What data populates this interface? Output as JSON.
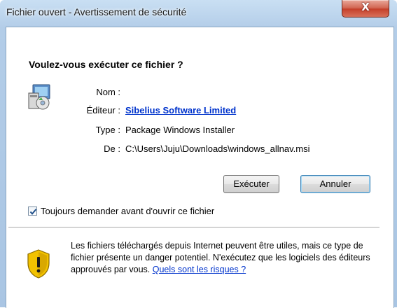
{
  "window": {
    "title": "Fichier ouvert - Avertissement de sécurité",
    "close_glyph": "X"
  },
  "question": "Voulez-vous exécuter ce fichier ?",
  "details": {
    "name_label": "Nom :",
    "name_value": "",
    "publisher_label": "Éditeur :",
    "publisher_value": "Sibelius Software Limited",
    "type_label": "Type :",
    "type_value": "Package Windows Installer",
    "from_label": "De :",
    "from_value": "C:\\Users\\Juju\\Downloads\\windows_allnav.msi"
  },
  "buttons": {
    "run": "Exécuter",
    "cancel": "Annuler"
  },
  "checkbox": {
    "label": "Toujours demander avant d'ouvrir ce fichier",
    "checked": true
  },
  "warning": {
    "text": "Les fichiers téléchargés depuis Internet peuvent être utiles, mais ce type de fichier présente un danger potentiel. N'exécutez que les logiciels des éditeurs approuvés par vous.",
    "link": "Quels sont les risques ?"
  },
  "icons": {
    "app": "installer-package-icon",
    "shield": "warning-shield-icon",
    "check": "checkmark-icon"
  },
  "colors": {
    "link": "#0033cc",
    "close_button": "#c5412b",
    "shield_yellow": "#f2c200"
  }
}
